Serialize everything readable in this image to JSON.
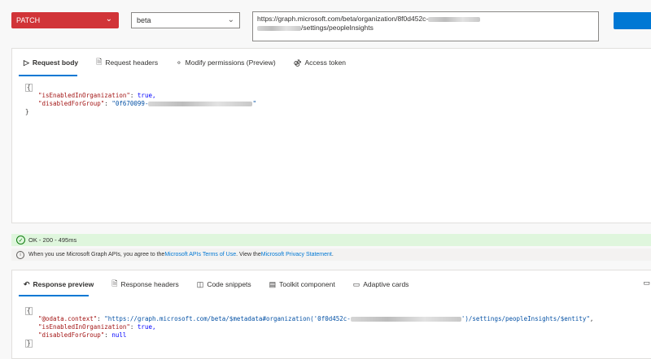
{
  "request": {
    "method": "PATCH",
    "version": "beta",
    "url_line1_prefix": "https://graph.microsoft.com/beta/organization/8f0d452c-",
    "url_line2_suffix": "/settings/peopleInsights"
  },
  "request_tabs": [
    {
      "label": "Request body",
      "icon": "send-icon"
    },
    {
      "label": "Request headers",
      "icon": "document-icon"
    },
    {
      "label": "Modify permissions (Preview)",
      "icon": "lock-shield-icon"
    },
    {
      "label": "Access token",
      "icon": "key-icon"
    }
  ],
  "request_body": {
    "open_brace": "{",
    "line1_key": "\"isEnabledInOrganization\"",
    "line1_value": "true,",
    "line2_key": "\"disabledForGroup\"",
    "line2_value_prefix": "\"0f670099-",
    "line2_value_end": "\"",
    "close_brace": "}"
  },
  "status": {
    "text": "OK - 200 - 495ms",
    "color": "#dff6dd"
  },
  "notice": {
    "prefix": "When you use Microsoft Graph APIs, you agree to the ",
    "link1": "Microsoft APIs Terms of Use",
    "middle": ". View the ",
    "link2": "Microsoft Privacy Statement",
    "suffix": "."
  },
  "response_tabs": [
    {
      "label": "Response preview",
      "icon": "reply-icon"
    },
    {
      "label": "Response headers",
      "icon": "document-icon"
    },
    {
      "label": "Code snippets",
      "icon": "code-icon"
    },
    {
      "label": "Toolkit component",
      "icon": "toolkit-icon"
    },
    {
      "label": "Adaptive cards",
      "icon": "card-icon"
    }
  ],
  "response_body": {
    "open_brace": "{",
    "line1_key": "\"@odata.context\"",
    "line1_value_prefix": "\"https://graph.microsoft.com/beta/$metadata#organization('0f0d452c-",
    "line1_value_suffix": "')/settings/peopleInsights/$entity\"",
    "line1_comma": ",",
    "line2_key": "\"isEnabledInOrganization\"",
    "line2_value": "true,",
    "line3_key": "\"disabledForGroup\"",
    "line3_value": "null",
    "close_brace": "}"
  },
  "colors": {
    "method_bg": "#d13438",
    "accent": "#0078d4",
    "success_bg": "#dff6dd"
  }
}
